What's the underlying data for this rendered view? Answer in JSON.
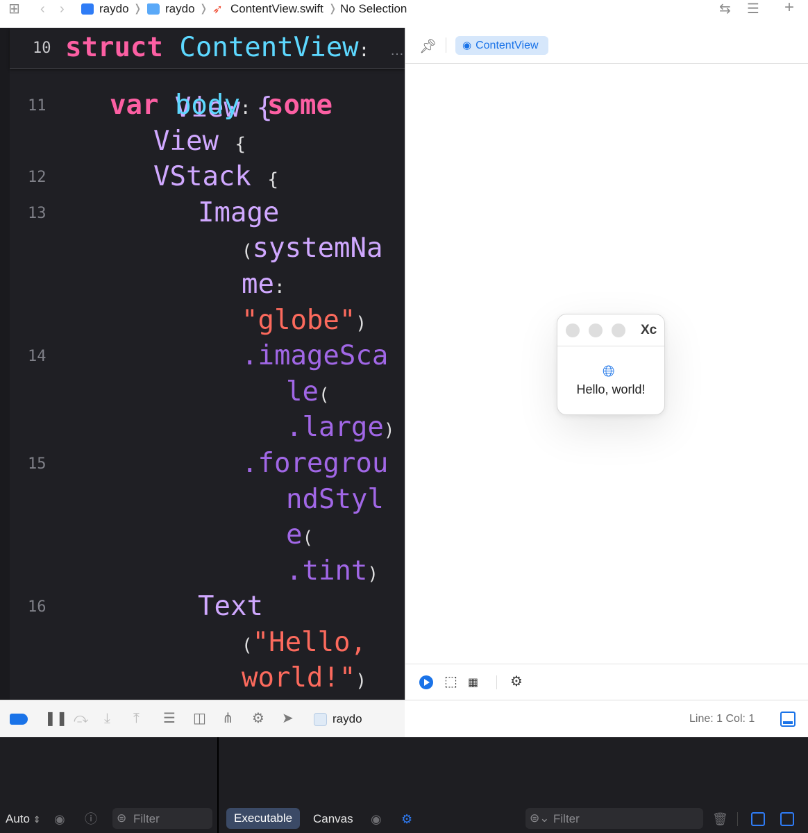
{
  "breadcrumb": {
    "project": "raydo",
    "folder": "raydo",
    "file": "ContentView.swift",
    "selection": "No Selection"
  },
  "editor": {
    "sticky_line_number": "10",
    "sticky_kw": "struct",
    "sticky_name": "ContentView",
    "sticky_colon": ":",
    "sticky_ellipsis": "…",
    "line_numbers": [
      "11",
      "12",
      "13",
      "14",
      "15",
      "16"
    ],
    "tokens": {
      "view_brace_frag": "View {",
      "var": "var",
      "body": "body",
      "colon": ":",
      "some": "some",
      "view": "View",
      "brace": "{",
      "vstack": "VStack",
      "image": "Image",
      "lparen": "(",
      "rparen": ")",
      "system_na": "systemNa",
      "me": "me",
      "globe_str": "\"globe\"",
      "image_sca": ".imageSca",
      "le": "le",
      "large": ".large",
      "foregrou": ".foregrou",
      "nd_styl": "ndStyl",
      "e": "e",
      "tint": ".tint",
      "text": "Text",
      "hello_str": "\"Hello,",
      "world_str": "world!\""
    }
  },
  "preview": {
    "chip_label": "ContentView",
    "window_title": "Xc",
    "hello_text": "Hello, world!"
  },
  "debug": {
    "scheme": "raydo",
    "line_col": "Line: 1  Col: 1"
  },
  "console": {
    "auto_label": "Auto",
    "filter_left": "Filter",
    "executable": "Executable",
    "canvas": "Canvas",
    "filter_right": "Filter"
  },
  "colors": {
    "accent": "#1a73e8",
    "editor_bg": "#1f1f24",
    "keyword": "#fc5fa3",
    "type": "#d0a8ff",
    "declaration": "#5dd8ff",
    "string": "#fc6a5d",
    "method": "#a167e6"
  }
}
